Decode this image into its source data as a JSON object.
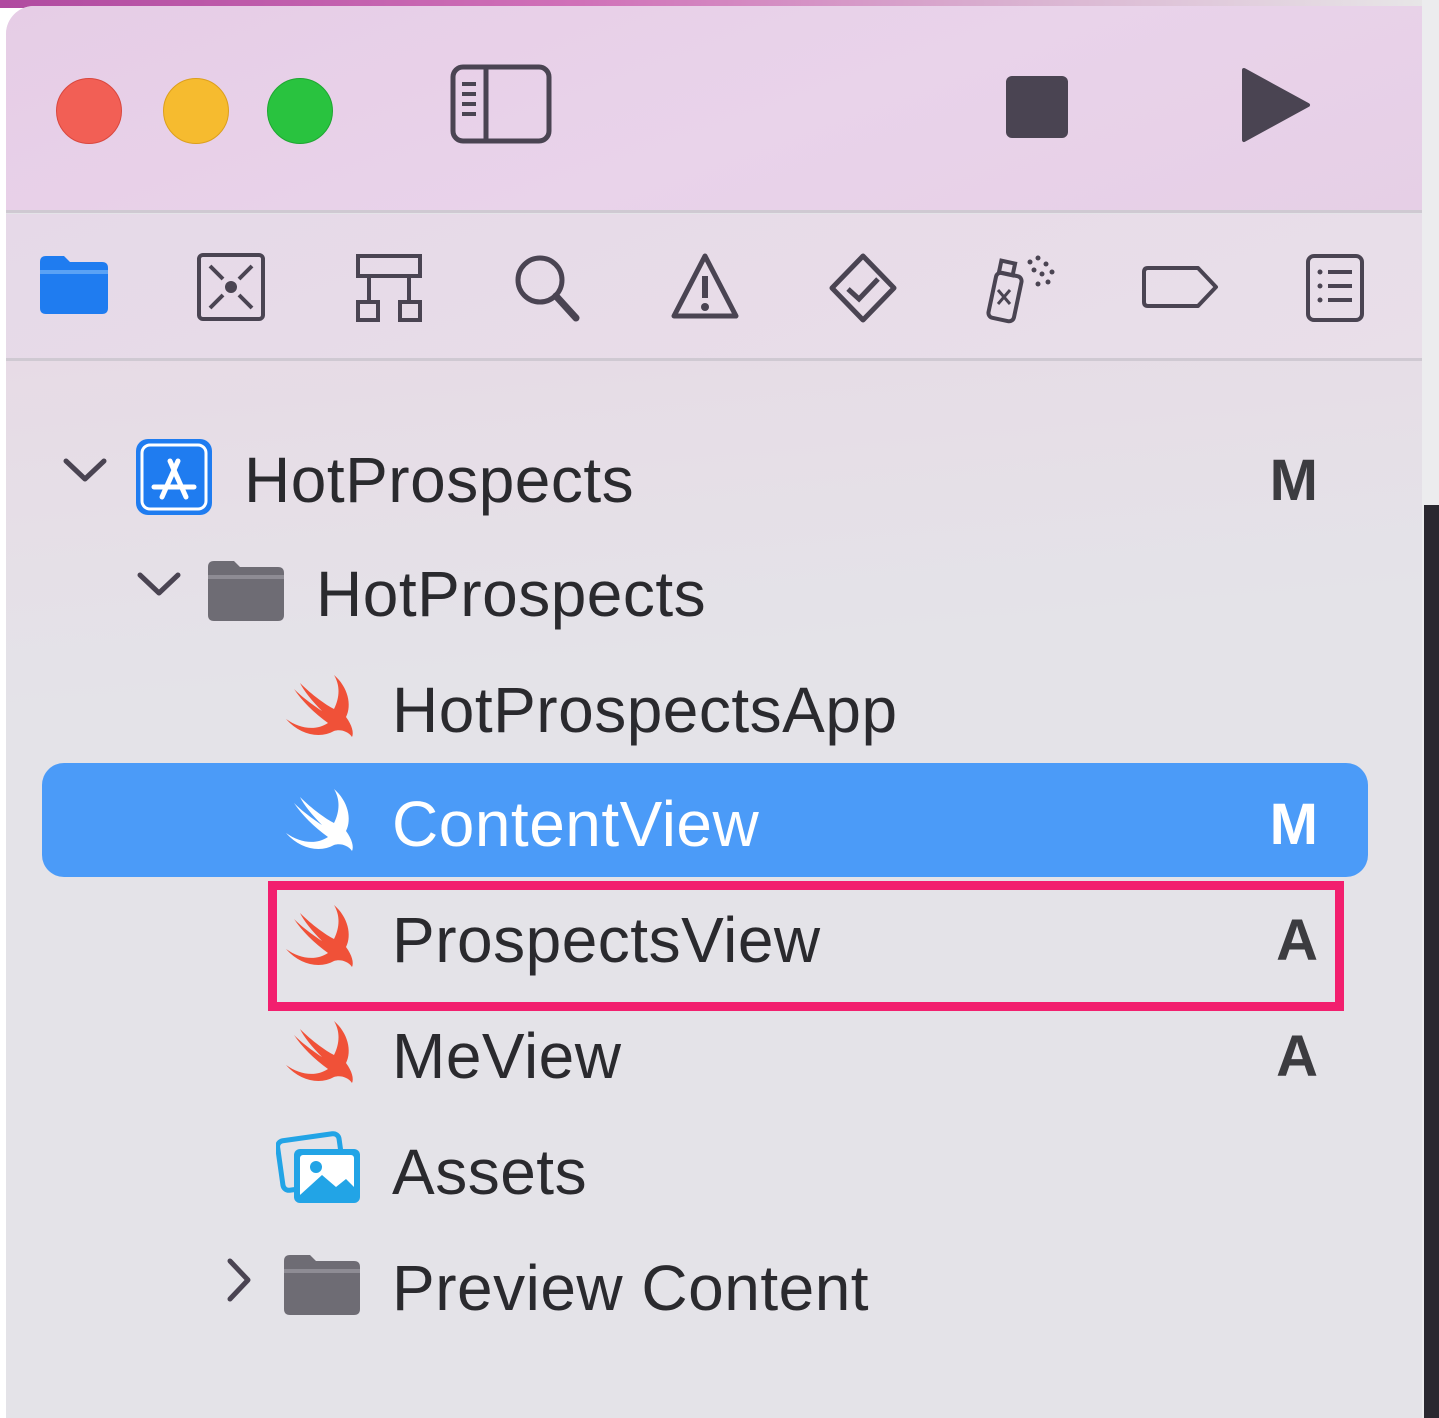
{
  "toolbar": {
    "icons": [
      "close-icon",
      "minimize-icon",
      "zoom-icon",
      "sidebar-toggle-icon",
      "stop-icon",
      "run-icon"
    ]
  },
  "navigator": {
    "tabs": [
      "project-navigator",
      "source-control-navigator",
      "symbol-navigator",
      "find-navigator",
      "issue-navigator",
      "test-navigator",
      "debug-navigator",
      "breakpoint-navigator",
      "report-navigator"
    ],
    "active_tab": "project-navigator"
  },
  "tree": {
    "project": {
      "label": "HotProspects",
      "badge": "M",
      "expanded": true
    },
    "group": {
      "label": "HotProspects",
      "expanded": true
    },
    "files": [
      {
        "label": "HotProspectsApp",
        "badge": "",
        "icon": "swift-icon"
      },
      {
        "label": "ContentView",
        "badge": "M",
        "icon": "swift-icon",
        "selected": true
      },
      {
        "label": "ProspectsView",
        "badge": "A",
        "icon": "swift-icon",
        "highlighted": true
      },
      {
        "label": "MeView",
        "badge": "A",
        "icon": "swift-icon"
      },
      {
        "label": "Assets",
        "badge": "",
        "icon": "asset-catalog-icon"
      },
      {
        "label": "Preview Content",
        "badge": "",
        "icon": "folder-icon",
        "expanded": false
      }
    ]
  },
  "colors": {
    "selection": "#4b9bf8",
    "highlight_border": "#f21f6e",
    "swift_orange": "#f05138",
    "accent_blue": "#1f7cf0"
  }
}
